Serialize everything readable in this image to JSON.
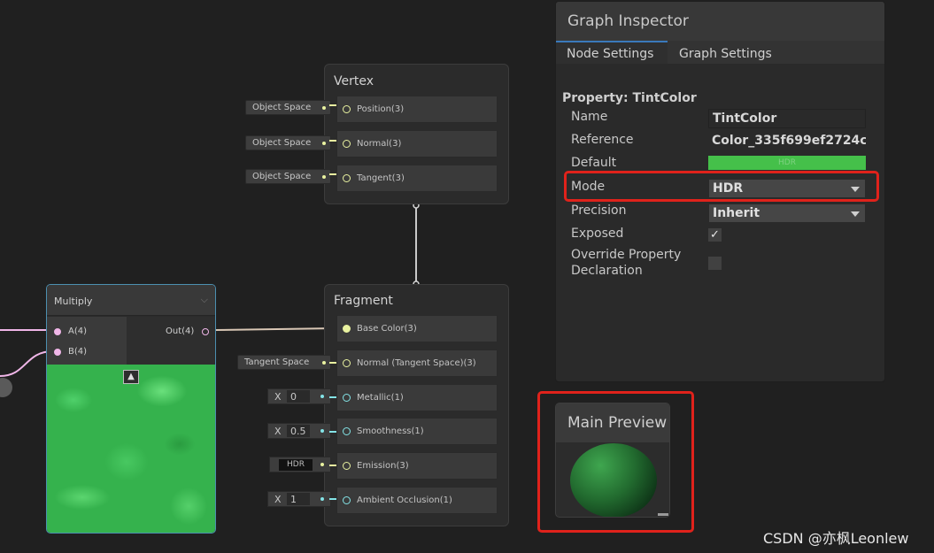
{
  "vertex": {
    "title": "Vertex",
    "slots": [
      {
        "label": "Position(3)",
        "input": "Object Space"
      },
      {
        "label": "Normal(3)",
        "input": "Object Space"
      },
      {
        "label": "Tangent(3)",
        "input": "Object Space"
      }
    ]
  },
  "fragment": {
    "title": "Fragment",
    "slots": [
      {
        "label": "Base Color(3)"
      },
      {
        "label": "Normal (Tangent Space)(3)",
        "input": "Tangent Space"
      },
      {
        "label": "Metallic(1)",
        "axis": "X",
        "value": "0"
      },
      {
        "label": "Smoothness(1)",
        "axis": "X",
        "value": "0.5"
      },
      {
        "label": "Emission(3)",
        "input": "HDR"
      },
      {
        "label": "Ambient Occlusion(1)",
        "axis": "X",
        "value": "1"
      }
    ]
  },
  "multiply": {
    "title": "Multiply",
    "inputs": [
      "A(4)",
      "B(4)"
    ],
    "output": "Out(4)"
  },
  "inspector": {
    "title": "Graph Inspector",
    "tabs": [
      "Node Settings",
      "Graph Settings"
    ],
    "active_tab": "Node Settings",
    "property_heading": "Property: TintColor",
    "rows": {
      "name": {
        "label": "Name",
        "value": "TintColor"
      },
      "reference": {
        "label": "Reference",
        "value": "Color_335f699ef2724c"
      },
      "default": {
        "label": "Default",
        "badge": "HDR",
        "color": "#45c04a"
      },
      "mode": {
        "label": "Mode",
        "value": "HDR"
      },
      "precision": {
        "label": "Precision",
        "value": "Inherit"
      },
      "exposed": {
        "label": "Exposed",
        "checked": true
      },
      "override": {
        "label_line1": "Override Property",
        "label_line2": "Declaration",
        "checked": false
      }
    }
  },
  "main_preview": {
    "title": "Main Preview"
  },
  "watermark": "CSDN @亦枫Leonlew",
  "colors": {
    "background": "#202020",
    "highlight": "#e0221b",
    "tab_accent": "#3a79bb",
    "vector_wire": "#e9f2a0",
    "float_wire": "#84e4e7",
    "dynamic_wire": "#f0b6e8"
  }
}
